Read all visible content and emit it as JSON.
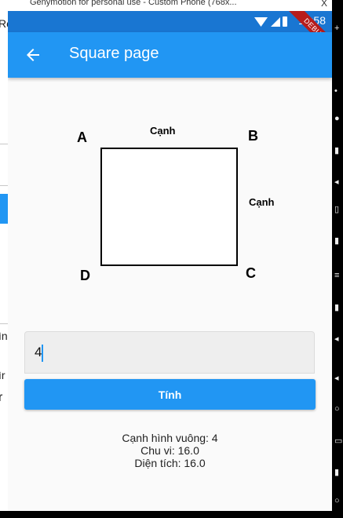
{
  "desktop": {
    "window_title": "Genymotion for personal use - Custom Phone (768x...",
    "close_glyph": "X",
    "left_fragments": [
      "Re",
      "ìn",
      "ìr",
      "r"
    ]
  },
  "status_bar": {
    "time": "12:58",
    "debug_banner": "DEBUG"
  },
  "app_bar": {
    "title": "Square page",
    "back_icon": "arrow-back-icon"
  },
  "diagram": {
    "corners": {
      "a": "A",
      "b": "B",
      "c": "C",
      "d": "D"
    },
    "side_top": "Cạnh",
    "side_right": "Cạnh"
  },
  "form": {
    "input_value": "4",
    "button_label": "Tính"
  },
  "results": {
    "side": "Cạnh hình vuông: 4",
    "perimeter": "Chu vi: 16.0",
    "area": "Diện tích: 16.0"
  },
  "colors": {
    "app_bar": "#2196f3",
    "status_bar": "#1976d2",
    "button": "#2196f3"
  }
}
